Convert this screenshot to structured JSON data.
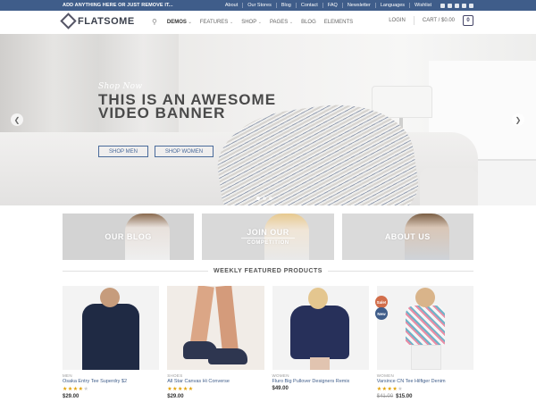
{
  "topbar": {
    "promo": "ADD ANYTHING HERE OR JUST REMOVE IT...",
    "links": [
      "About",
      "Our Stores",
      "Blog",
      "Contact",
      "FAQ",
      "Newsletter",
      "Languages",
      "Wishlist"
    ]
  },
  "header": {
    "logo": "FLATSOME",
    "nav": [
      "DEMOS",
      "FEATURES",
      "SHOP",
      "PAGES",
      "BLOG",
      "ELEMENTS"
    ],
    "login": "LOGIN",
    "cart": "CART / $0.00",
    "cart_count": "0"
  },
  "hero": {
    "kicker": "Shop Now",
    "title": "THIS IS AN AWESOME VIDEO BANNER",
    "btn_men": "SHOP MEN",
    "btn_women": "SHOP WOMEN"
  },
  "banners": [
    {
      "title": "OUR BLOG",
      "sub": ""
    },
    {
      "title": "JOIN OUR",
      "sub": "COMPETITION"
    },
    {
      "title": "ABOUT US",
      "sub": ""
    }
  ],
  "featured": {
    "title": "WEEKLY FEATURED PRODUCTS",
    "products": [
      {
        "category": "MEN",
        "name": "Osaka Entry Tee Superdry $2",
        "stars": 4,
        "price": "$29.00",
        "old_price": ""
      },
      {
        "category": "SHOES",
        "name": "All Star Canvas Hi Converse",
        "stars": 5,
        "price": "$29.00",
        "old_price": ""
      },
      {
        "category": "WOMEN",
        "name": "Fluro Big Pullover Designers Remix",
        "stars": 0,
        "price": "$49.00",
        "old_price": ""
      },
      {
        "category": "WOMEN",
        "name": "Varsince CN Tee Hilfiger Denim",
        "stars": 4,
        "price": "$15.00",
        "old_price": "$41.00"
      }
    ],
    "badges": {
      "sale": "Sale!",
      "new": "New"
    }
  },
  "colors": {
    "brand": "#3f5d8a",
    "star": "#e1a000",
    "sale": "#d26e4b"
  }
}
